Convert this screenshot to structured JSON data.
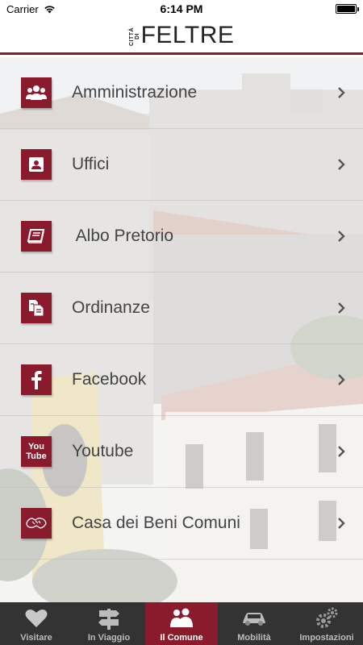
{
  "status_bar": {
    "carrier": "Carrier",
    "time": "6:14 PM"
  },
  "header": {
    "logo_small": "CITTÀ DI",
    "logo_big": "FELTRE"
  },
  "menu": [
    {
      "label": "Amministrazione",
      "icon": "group-icon"
    },
    {
      "label": "Uffici",
      "icon": "contact-card-icon"
    },
    {
      "label": " Albo Pretorio",
      "icon": "book-icon"
    },
    {
      "label": "Ordinanze",
      "icon": "documents-icon"
    },
    {
      "label": "Facebook",
      "icon": "facebook-icon"
    },
    {
      "label": "Youtube",
      "icon": "youtube-icon"
    },
    {
      "label": "Casa dei Beni Comuni",
      "icon": "hands-icon"
    }
  ],
  "youtube_icon_text": {
    "top": "You",
    "bottom": "Tube"
  },
  "tabs": [
    {
      "label": "Visitare",
      "icon": "heart-icon",
      "active": false
    },
    {
      "label": "In Viaggio",
      "icon": "signpost-icon",
      "active": false
    },
    {
      "label": "Il Comune",
      "icon": "people-icon",
      "active": true
    },
    {
      "label": "Mobilità",
      "icon": "car-icon",
      "active": false
    },
    {
      "label": "Impostazioni",
      "icon": "gears-icon",
      "active": false
    }
  ],
  "colors": {
    "accent": "#8a1b2c",
    "tabbar": "#333333"
  }
}
